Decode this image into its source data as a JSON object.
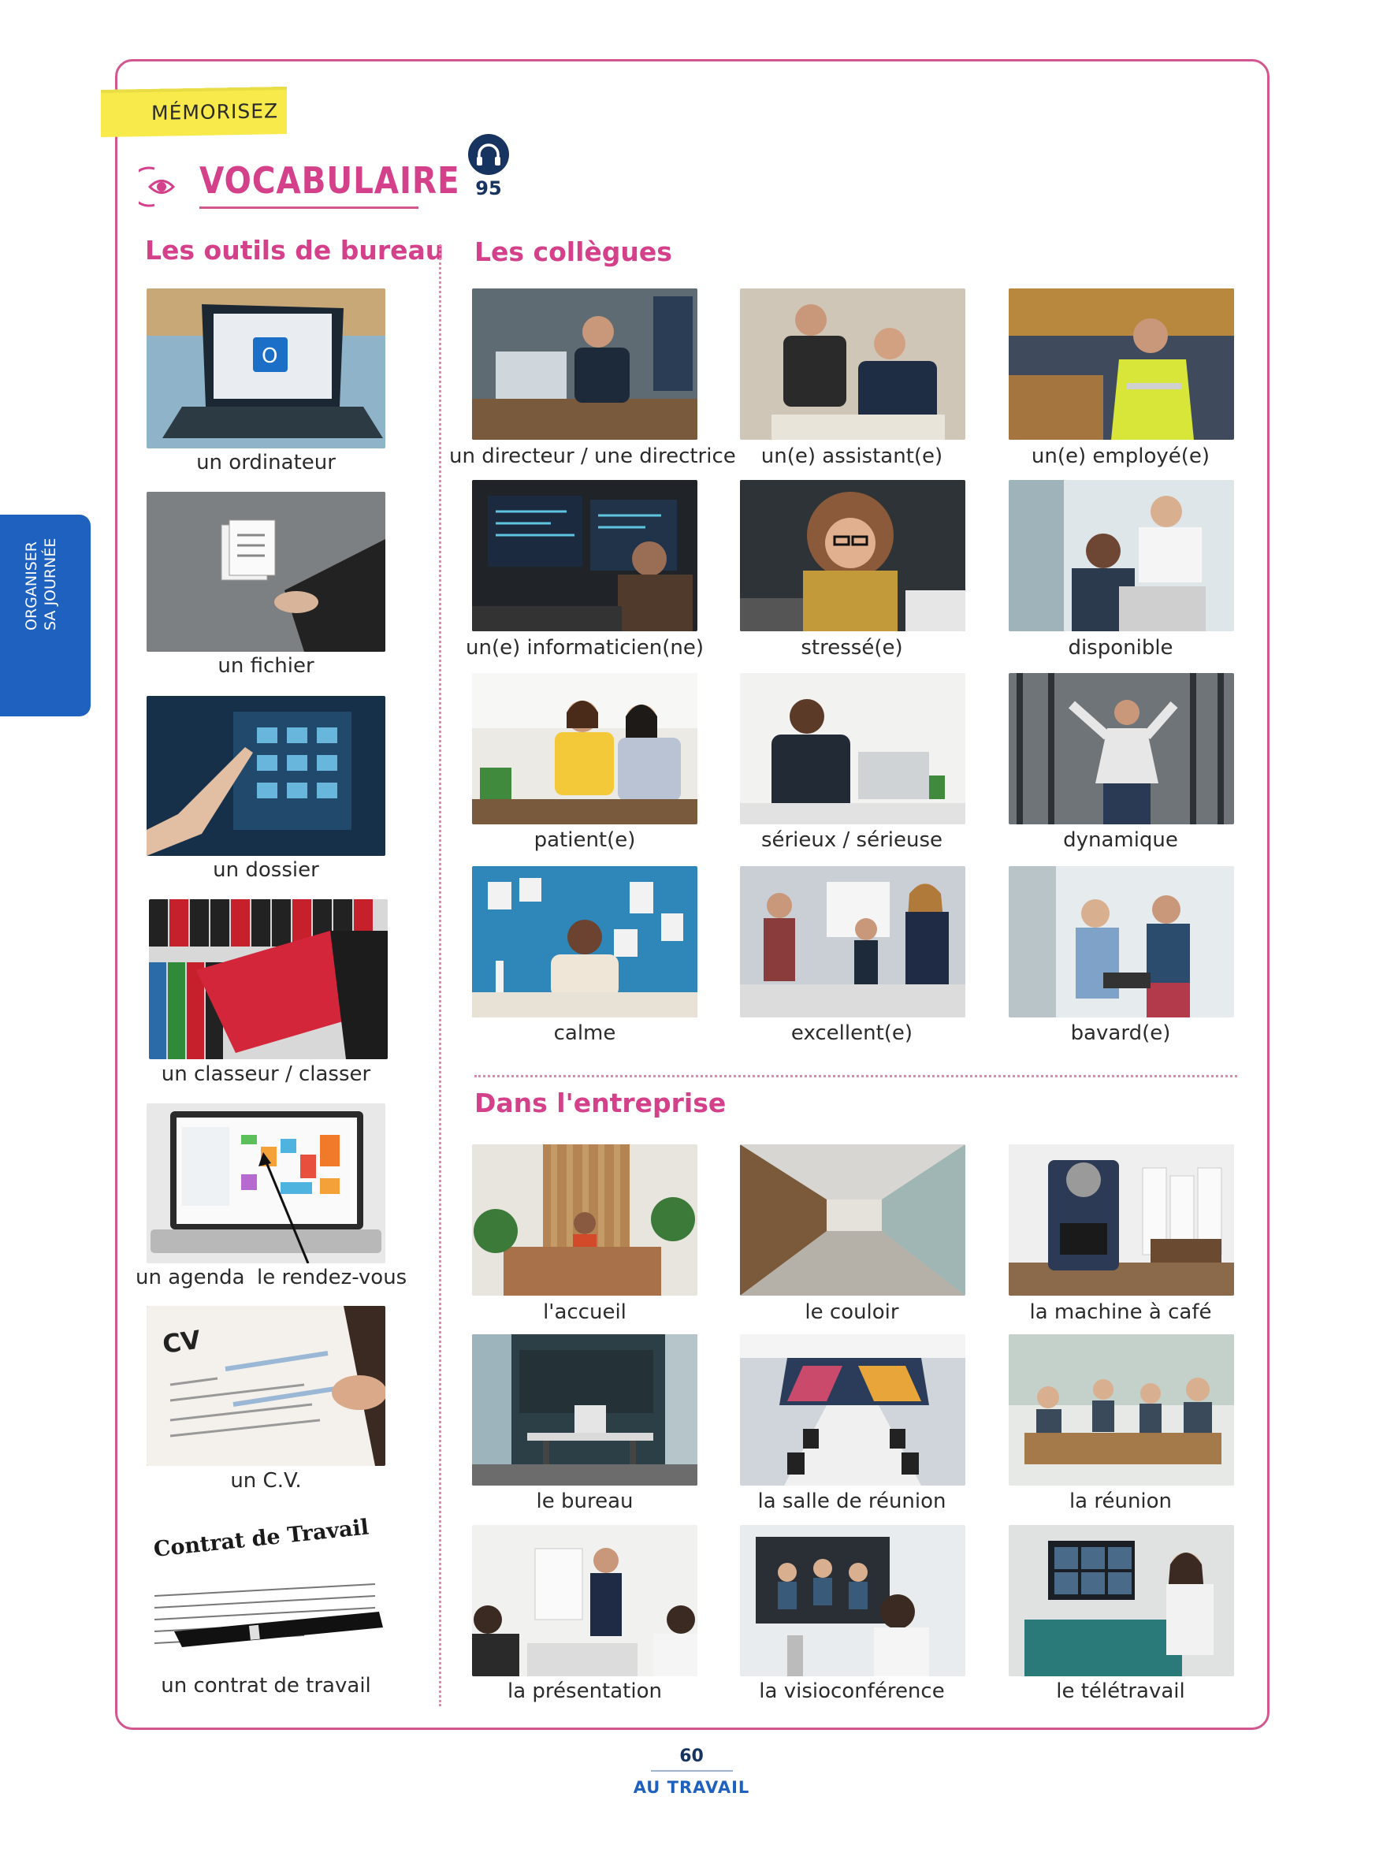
{
  "tag": "MÉMORISEZ",
  "heading": {
    "title": "VOCABULAIRE",
    "audio_track": "95"
  },
  "side_tab": {
    "line1": "ORGANISER",
    "line2": "SA JOURNÉE"
  },
  "sections": {
    "outils": {
      "title": "Les outils de bureau",
      "items": [
        {
          "caption": "un ordinateur",
          "icon": "laptop-outlook-photo"
        },
        {
          "caption": "un fichier",
          "icon": "file-photo"
        },
        {
          "caption": "un dossier",
          "icon": "folder-photo"
        },
        {
          "caption": "un classeur / classer",
          "icon": "binder-photo"
        },
        {
          "caption_left": "un agenda",
          "caption_right": "le rendez-vous",
          "icon": "calendar-photo"
        },
        {
          "caption": "un C.V.",
          "icon": "cv-photo",
          "photo_text": "CV"
        },
        {
          "caption": "un contrat de travail",
          "icon": "contract-photo",
          "photo_text": "Contrat de Travail"
        }
      ]
    },
    "collegues": {
      "title": "Les collègues",
      "items": [
        {
          "caption": "un directeur / une directrice",
          "icon": "director-photo"
        },
        {
          "caption": "un(e) assistant(e)",
          "icon": "assistant-photo"
        },
        {
          "caption": "un(e) employé(e)",
          "icon": "employee-photo"
        },
        {
          "caption": "un(e) informaticien(ne)",
          "icon": "it-photo"
        },
        {
          "caption": "stressé(e)",
          "icon": "stressed-photo"
        },
        {
          "caption": "disponible",
          "icon": "available-photo"
        },
        {
          "caption": "patient(e)",
          "icon": "patient-photo"
        },
        {
          "caption": "sérieux / sérieuse",
          "icon": "serious-photo"
        },
        {
          "caption": "dynamique",
          "icon": "dynamic-photo"
        },
        {
          "caption": "calme",
          "icon": "calm-photo"
        },
        {
          "caption": "excellent(e)",
          "icon": "excellent-photo"
        },
        {
          "caption": "bavard(e)",
          "icon": "chatty-photo"
        }
      ]
    },
    "entreprise": {
      "title": "Dans l'entreprise",
      "items": [
        {
          "caption": "l'accueil",
          "icon": "reception-photo"
        },
        {
          "caption": "le couloir",
          "icon": "corridor-photo"
        },
        {
          "caption": "la machine à café",
          "icon": "coffee-machine-photo"
        },
        {
          "caption": "le bureau",
          "icon": "office-photo"
        },
        {
          "caption": "la salle de réunion",
          "icon": "meeting-room-photo"
        },
        {
          "caption": "la réunion",
          "icon": "meeting-photo"
        },
        {
          "caption": "la présentation",
          "icon": "presentation-photo"
        },
        {
          "caption": "la visioconférence",
          "icon": "videoconference-photo"
        },
        {
          "caption": "le télétravail",
          "icon": "remote-work-photo"
        }
      ]
    }
  },
  "footer": {
    "page": "60",
    "chapter": "AU TRAVAIL"
  },
  "colors": {
    "accent": "#d4418a",
    "frame": "#d4568f",
    "tab": "#1f61bf",
    "navy": "#17335f",
    "highlight": "#f7ea4a"
  }
}
